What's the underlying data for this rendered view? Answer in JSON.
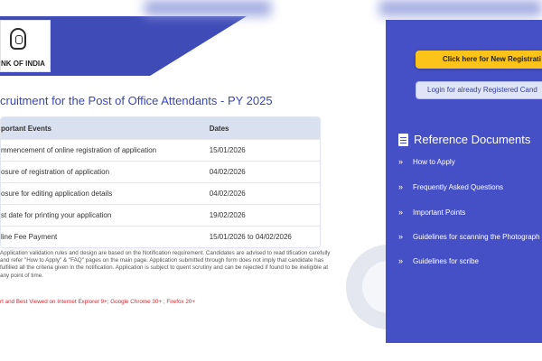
{
  "header": {
    "logo_text": "NK OF INDIA"
  },
  "page_title": "cruitment for the Post of Office Attendants - PY 2025",
  "events_table": {
    "headers": [
      "portant Events",
      "Dates"
    ],
    "rows": [
      {
        "event": "mmencement of online registration of application",
        "date": "15/01/2026"
      },
      {
        "event": "osure of registration of application",
        "date": "04/02/2026"
      },
      {
        "event": "osure for editing application details",
        "date": "04/02/2026"
      },
      {
        "event": "st date for printing your application",
        "date": "19/02/2026"
      },
      {
        "event": "line Fee Payment",
        "date": "15/01/2026 to 04/02/2026"
      }
    ]
  },
  "notes": "Application validation rules and design are based on the Notification requirement. Candidates are advised to read tification carefully and refer \"How to Apply\" & \"FAQ\" pages on the main page. Application submitted through form does not imply that candidate has fulfilled all the criteria given in the notification. Application is subject to quent scrutiny and can be rejected if found to be ineligible at any point of time.",
  "best_viewed": "rt and Best Viewed on Internet Explorer 9+; Google Chrome 30+ ; Firefox 20+",
  "right_panel": {
    "new_registration_label": "Click here for New Registrati",
    "login_label": "Login for already Registered Cand",
    "reference_title": "Reference Documents",
    "links": [
      "How to Apply",
      "Frequently Asked Questions",
      "Important Points",
      "Guidelines for scanning the Photograph",
      "Guidelines for scribe"
    ]
  },
  "colors": {
    "brand_blue": "#3f4cb8",
    "panel_blue": "#4650c6",
    "cta_yellow": "#fcc419",
    "table_header": "#d9e0ef",
    "warning_red": "#e0232b"
  }
}
